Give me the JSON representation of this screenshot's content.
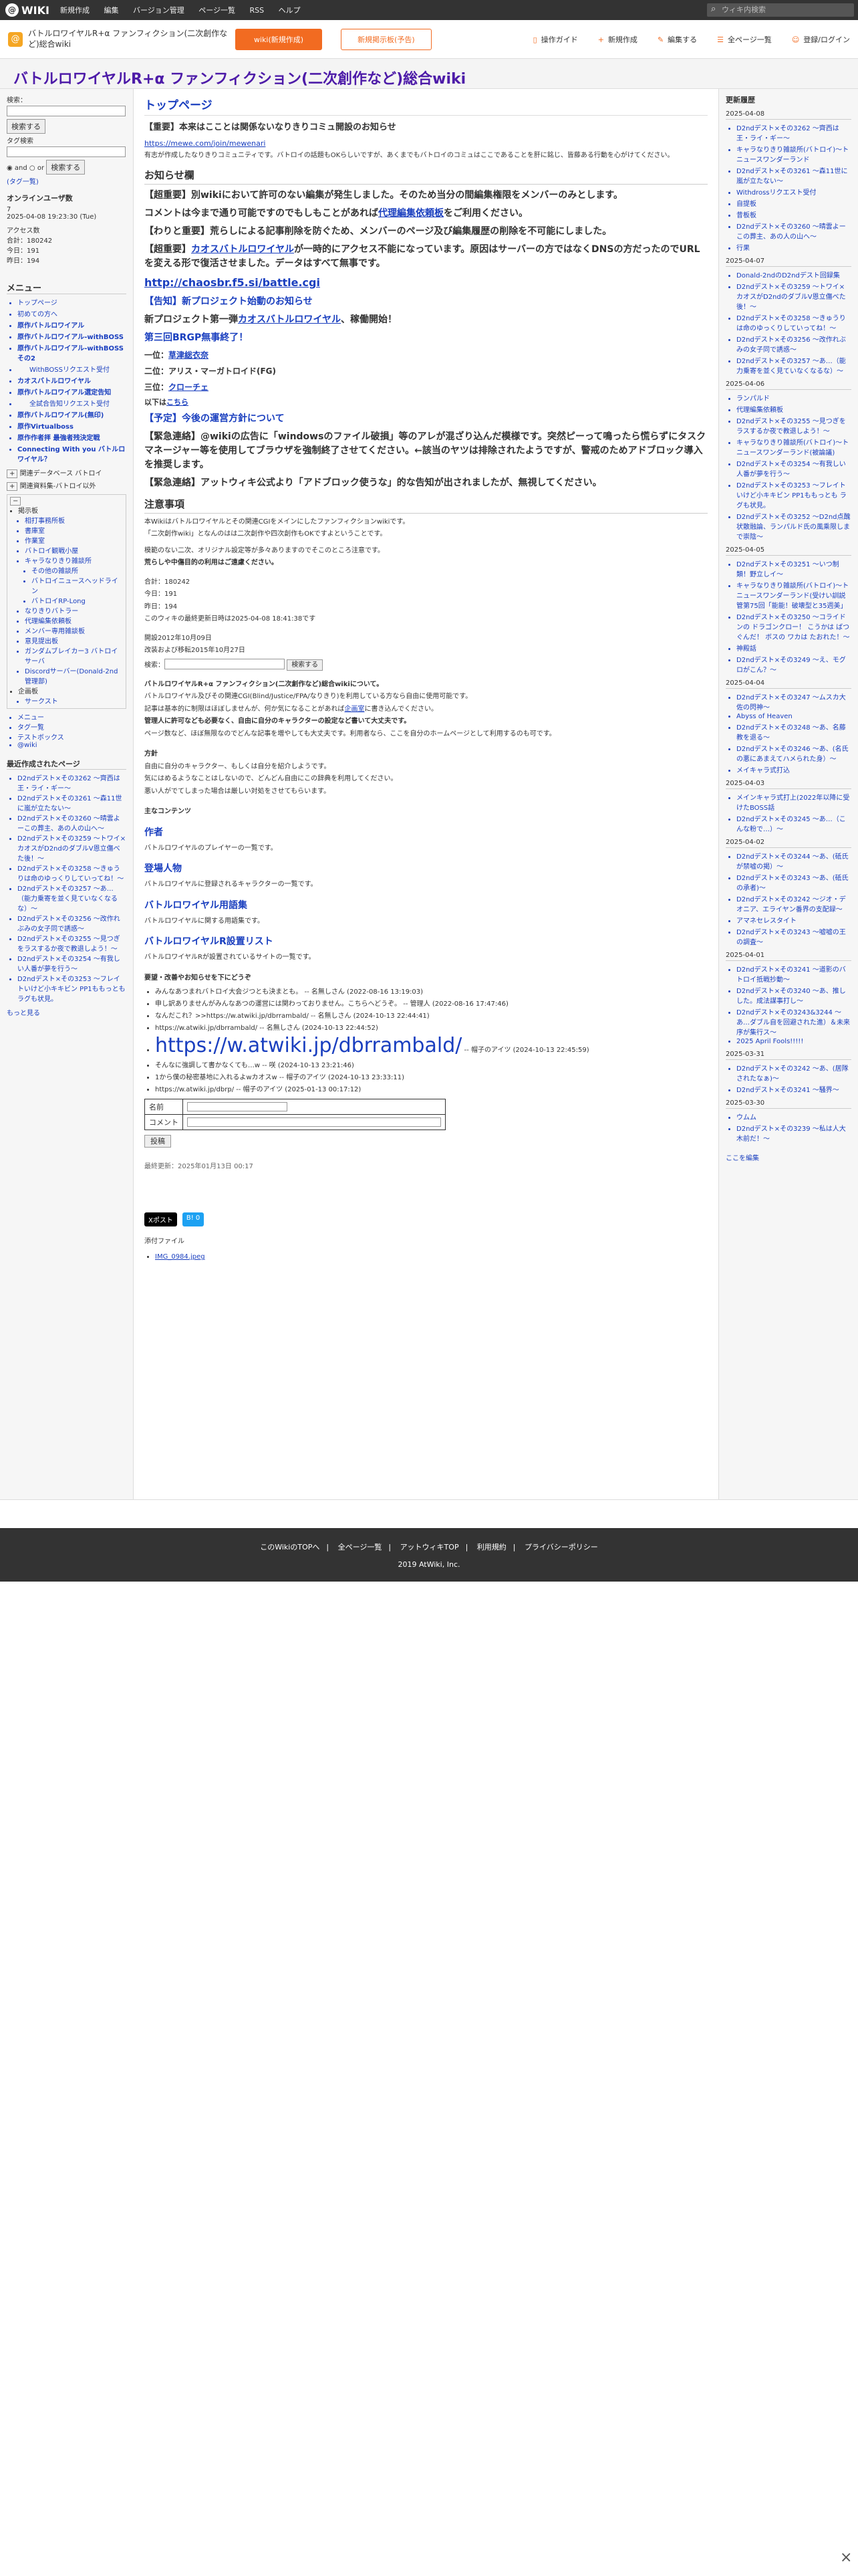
{
  "topbar": {
    "logo": "WIKI",
    "menu": [
      "新規作成",
      "編集",
      "バージョン管理",
      "ページ一覧",
      "RSS",
      "ヘルプ"
    ],
    "search_placeholder": "ウィキ内検索"
  },
  "wikihead": {
    "title": "バトルロワイヤルR+α ファンフィクション(二次創作など)総合wiki",
    "btn_orange": "wiki(新規作成)",
    "btn_outline": "新規掲示板(予告)",
    "tools": [
      "操作ガイド",
      "新規作成",
      "編集する",
      "全ページ一覧",
      "登録/ログイン"
    ]
  },
  "site_title": "バトルロワイヤルR+α ファンフィクション(二次創作など)総合wiki",
  "left": {
    "search_label": "検索：",
    "search_btn": "検索する",
    "search2_label": "タグ検索",
    "radio_and": "and",
    "radio_or": "or",
    "search2_btn": "検索する",
    "tag_label": "(タグ一覧)",
    "online_title": "オンラインユーザ数",
    "online_count": "7",
    "datetime": "2025-04-08 19:23:30 (Tue)",
    "access_title": "アクセス数",
    "access_total": "合計：180242",
    "access_today": "今日：191",
    "access_yesterday": "昨日：194",
    "menu_title": "メニュー",
    "menu": [
      "トップページ",
      "初めての方へ",
      "原作バトルロワイアル",
      "原作バトルロワイアル-withBOSS",
      "原作バトルロワイアル-withBOSSその2",
      "WithBOSSリクエスト受付",
      "カオスバトルロワイヤル",
      "原作バトルロワイアル選定告知",
      "全試合告知リクエスト受付",
      "原作バトルロワイアル(無印)",
      "原作Virtualboss",
      "原作作者拝 最強者残決定戦",
      "Connecting With you バトルロワイヤル？"
    ],
    "links": [
      "関連データベース バトロイ",
      "関連資料集-バトロイ以外"
    ],
    "tree_title": "掲示板",
    "tree": [
      "相打事務所板",
      "書庫室",
      "作業室",
      "バトロイ観戦小屋",
      "キャラなりきり雑談所",
      "その他の雑談所",
      "バトロイニュースへッドライン",
      "バトロイRP-Long",
      "なりきりバトラー",
      "代理編集依頼板",
      "メンバー専用雑談板",
      "意見提出板",
      "ガンダムブレイカー3 バトロイサーバ",
      "Discordサーバー(Donald-2nd管理部)"
    ],
    "misc": [
      "企画板",
      "サークスト"
    ],
    "extra": [
      "メニュー",
      "タグ一覧",
      "テストボックス",
      "@wiki"
    ],
    "recent_title": "最近作成されたページ",
    "recent": [
      "D2ndデスト×その3262 〜齊西は王・ライ・ギー〜",
      "D2ndデスト×その3261 〜森11世に嵐が立たない〜",
      "D2ndデスト×その3260 〜晴雲よーこの葬主、あの人の山へ〜",
      "D2ndデスト×その3259 〜トワイ×カオスがD2ndのダブルV恩立傷べた後！〜",
      "D2ndデスト×その3258 〜きゅうりは命のゆっくりしていってね！〜",
      "D2ndデスト×その3257 〜あ…（能力乗寄を並く見ていなくなるな）〜",
      "D2ndデスト×その3256 〜改作れぶみの女子同で誘惑〜",
      "D2ndデスト×その3255 〜見つぎをラスするか夜で教退しよう！〜",
      "D2ndデスト×その3254 〜有我しい人番が夢を行う〜",
      "D2ndデスト×その3253 〜フレイトいけど小キキビン PP1ももっとも ラグも状見。"
    ],
    "more": "もっと見る"
  },
  "main": {
    "page_title": "トップページ",
    "notice1": "【重要】本来はこことは関係ないなりきりコミュ開設のお知らせ",
    "url1": "https://mewe.com/join/mewenari",
    "notice1_text": "有志が作成したなりきりコミュニティです。バトロイの話題もOKらしいですが、あくまでもバトロイのコミュはここであることを肝に銘じ、皆藤ある行動を心がけてください。",
    "announce_title": "お知らせ欄",
    "n1a": "【超重要】別wikiにおいて許可のない編集が発生しました。そのため当分の間編集権限をメンバーのみとします。",
    "n1b": "コメントは今まで通り可能ですのでもしもことがあれば",
    "n1link": "代理編集依頼板",
    "n1c": "をご利用ください。",
    "n2": "【わりと重要】荒らしによる記事削除を防ぐため、メンバーのページ及び編集履歴の削除を不可能にしました。",
    "n3a": "【超重要】",
    "n3link": "カオスバトルロワイヤル",
    "n3b": "が一時的にアクセス不能になっています。原因はサーバーの方ではなくDNSの方だったのでURLを変える形で復活させました。データはすべて無事です。",
    "n3url": "http://chaosbr.f5.si/battle.cgi",
    "n4": "【告知】新プロジェクト始動のお知らせ",
    "n5a": "新プロジェクト第一弾",
    "n5link": "カオスバトルロワイヤル",
    "n5b": "、稼働開始！",
    "n6": "第三回BRGP無事終了！",
    "r1label": "一位：",
    "r1": "草津総衣奈",
    "r2": "二位：アリス・マーガトロイド(FG)",
    "r3label": "三位：",
    "r3": "クローチェ",
    "more_label": "以下は",
    "more_link": "こちら",
    "n7": "【予定】今後の運営方針について",
    "n8": "【緊急連絡】@wikiの広告に「windowsのファイル破損」等のアレが混ざり込んだ模様です。突然ピーって鳴ったら慌らずにタスクマネージャー等を使用してブラウザを強制終了させてください。←該当のヤツは排除されたようですが、警戒のためアドブロック導入を推奨します。",
    "n9": "【緊急連絡】アットウィキ公式より「アドブロック使うな」的な告知が出されましたが、無視してください。",
    "caution_title": "注意事項",
    "c1": "本Wikiはバトルロワイヤルとその関連CGIをメインにしたファンフィクションwikiです。",
    "c2": "「二次創作wiki」となんのはは二次創作や四次創作もOKですよということです。",
    "c3": "模範のない二次、オリジナル設定等が多々ありますのでそこのところ注意です。",
    "c4": "荒らしや中傷目的の利用はご遠慮ください。",
    "stats": [
      "合計：180242",
      "今日：191",
      "昨日：194"
    ],
    "updated": "このウィキの最終更新日時は2025-04-08 18:41:38です",
    "opened": "開設2012年10月09日",
    "moved": "改装および移転2015年10月27日",
    "search_label": "検索：",
    "search_btn": "検索する",
    "intro_title": "バトルロワイヤルR+α ファンフィクション(二次創作など)総合wikiについて。",
    "intro1": "バトルロワイヤル及びその関連CGI(Blind/Justice/FPA/なりきり)を利用している方なら自由に使用可能です。",
    "intro2": "記事は基本的に制限はほぼしませんが、何か気になることがあれば",
    "intro2link": "企画室",
    "intro2b": "に書き込んでください。",
    "intro3": "管理人に許可なども必要なく、自由に自分のキャラクターの設定など書いて大丈夫です。",
    "intro4": "ページ数など、ほぼ無限なのでどんな記事を増やしても大丈夫です。利用者なら、ここを自分のホームページとして利用するのも可です。",
    "policy_title": "方針",
    "p1": "自由に自分のキャラクター、もしくは自分を紹介しようです。",
    "p2": "気にはめるようなことはしないので、どんどん自由にこの辞典を利用してください。",
    "p3": "悪い人がでてしまった場合は厳しい対処をさせてもらいます。",
    "contents_title": "主なコンテンツ",
    "author_title": "作者",
    "author_text": "バトルロワイヤルのプレイヤーの一覧です。",
    "chars_title": "登場人物",
    "chars_text": "バトルロワイヤルに登録されるキャラクターの一覧です。",
    "terms_title": "バトルロワイヤル用語集",
    "terms_text": "バトルロワイヤルに関する用語集です。",
    "sites_title": "バトルロワイヤルR設置リスト",
    "sites_text": "バトルロワイヤルRが設置されているサイトの一覧です。",
    "comment_title": "要望・改善やお知らせを下にどうぞ",
    "comments": [
      "みんなあつまれバトロイ大会ジつとも決まとも。 -- 名無しさん (2022-08-16 13:19:03)",
      "申し訳ありませんがみんなあつの運営には関わっておりません。こちらへどうぞ。 -- 管理人 (2022-08-16 17:47:46)",
      "なんだこれ？>>https://w.atwiki.jp/dbrrambald/ -- 名無しさん (2024-10-13 22:44:41)",
      "https://w.atwiki.jp/dbrrambald/ -- 名無しさん (2024-10-13 22:44:52)"
    ],
    "big_url": "https://w.atwiki.jp/dbrrambald/",
    "big_url_suffix": "-- 帽子のアイツ (2024-10-13 22:45:59)",
    "comments2": [
      "そんなに強調して書かなくても…w -- 咲 (2024-10-13 23:21:46)",
      "1から僕の秘密基地に入れるよwカオスw -- 帽子のアイツ (2024-10-13 23:33:11)",
      "https://w.atwiki.jp/dbrp/ -- 帽子のアイツ (2025-01-13 00:17:12)"
    ],
    "form_name": "名前",
    "form_comment": "コメント",
    "post_btn": "投稿",
    "last_updated": "最終更新：2025年01月13日 00:17",
    "share_x": "Xポスト",
    "share_b": "B! 0",
    "attach_title": "添付ファイル",
    "attach": "IMG_0984.jpeg"
  },
  "right": {
    "title": "更新履歴",
    "groups": [
      {
        "date": "2025-04-08",
        "items": [
          "D2ndデスト×その3262 〜齊西は王・ライ・ギー〜",
          "キャラなりきり雑談所(バトロイ)〜トニュースワンダーランド",
          "D2ndデスト×その3261 〜森11世に嵐が立たない〜",
          "Withdrossリクエスト受付",
          "自提板",
          "昔板板",
          "D2ndデスト×その3260 〜晴雲よーこの葬主、あの人の山へ〜",
          "行果"
        ]
      },
      {
        "date": "2025-04-07",
        "items": [
          "Donald-2ndのD2ndデスト回録集",
          "D2ndデスト×その3259 〜トワイ×カオスがD2ndのダブルV恩立傷べた後！〜",
          "D2ndデスト×その3258 〜きゅうりは命のゆっくりしていってね！〜",
          "D2ndデスト×その3256 〜改作れぶみの女子同で誘惑〜",
          "D2ndデスト×その3257 〜あ…（能力乗寄を並く見ていなくなるな）〜"
        ]
      },
      {
        "date": "2025-04-06",
        "items": [
          "ランパルド",
          "代理編集依頼板",
          "D2ndデスト×その3255 〜見つぎをラスするか夜で教退しよう！〜",
          "キャラなりきり雑談所(バトロイ)〜トニュースワンダーランド(被論議)",
          "D2ndデスト×その3254 〜有我しい人番が夢を行う〜",
          "D2ndデスト×その3253 〜フレイトいけど小キキビン PP1ももっとも ラグも状見。",
          "D2ndデスト×その3252 〜D2nd点醜状散融論、ランパルド氏の風乘限しまで崇陰〜"
        ]
      },
      {
        "date": "2025-04-05",
        "items": [
          "D2ndデスト×その3251 〜いつ制類！野立しイ〜",
          "キャラなりきり雑談所(バトロイ)〜トニュースワンダーランド(受けい訓説管第75回「能能！破壊型と35週美」",
          "D2ndデスト×その3250 〜コライドンの ドラゴンクロー！ こうかは ばつぐんだ！ ボスの ワカは たおれた！〜",
          "神殿話",
          "D2ndデスト×その3249 〜え、モグロがこん？〜"
        ]
      },
      {
        "date": "2025-04-04",
        "items": [
          "D2ndデスト×その3247 〜ムスカ大佐の閃神〜",
          "Abyss of Heaven",
          "D2ndデスト×その3248 〜あ、名藤教を退る〜",
          "D2ndデスト×その3246 〜あ、(名氏の悪にあまえてハメられた身）〜",
          "メイキャラ式打込"
        ]
      },
      {
        "date": "2025-04-03",
        "items": [
          "メインキャラ式打上(2022年以降に受けたBOSS話",
          "D2ndデスト×その3245 〜あ…（こんな粉で…）〜"
        ]
      },
      {
        "date": "2025-04-02",
        "items": [
          "D2ndデスト×その3244 〜あ、(砥氏が禁嘘の掲）〜",
          "D2ndデスト×その3243 〜あ、(砥氏の承者)〜",
          "D2ndデスト×その3242 〜ジオ・デオニア、エライヤン番界の支配録〜",
          "アマネセレスタイト",
          "D2ndデスト×その3243 〜嘘嘘の王の調査〜"
        ]
      },
      {
        "date": "2025-04-01",
        "items": [
          "D2ndデスト×その3241 〜道影のバトロイ抵戦抄動〜",
          "D2ndデスト×その3240 〜あ、推しした。成法謀事打し〜",
          "D2ndデスト×その3243&3244 〜あ…ダブル自を回避された進）＆未来序が集行ス〜",
          "2025 April Fools!!!!!"
        ]
      },
      {
        "date": "2025-03-31",
        "items": [
          "D2ndデスト×その3242 〜あ、(居隊されたなぁ)〜",
          "D2ndデスト×その3241 〜騒界〜"
        ]
      },
      {
        "date": "2025-03-30",
        "items": [
          "ウムム",
          "D2ndデスト×その3239 〜私は人大木前だ！〜"
        ]
      }
    ],
    "more": "ここを編集"
  },
  "footer": {
    "links": [
      "このWikiのTOPへ",
      "全ページ一覧",
      "アットウィキTOP",
      "利用規約",
      "プライバシーポリシー"
    ],
    "copy": "2019 AtWiki, Inc."
  },
  "close_icon": "×"
}
